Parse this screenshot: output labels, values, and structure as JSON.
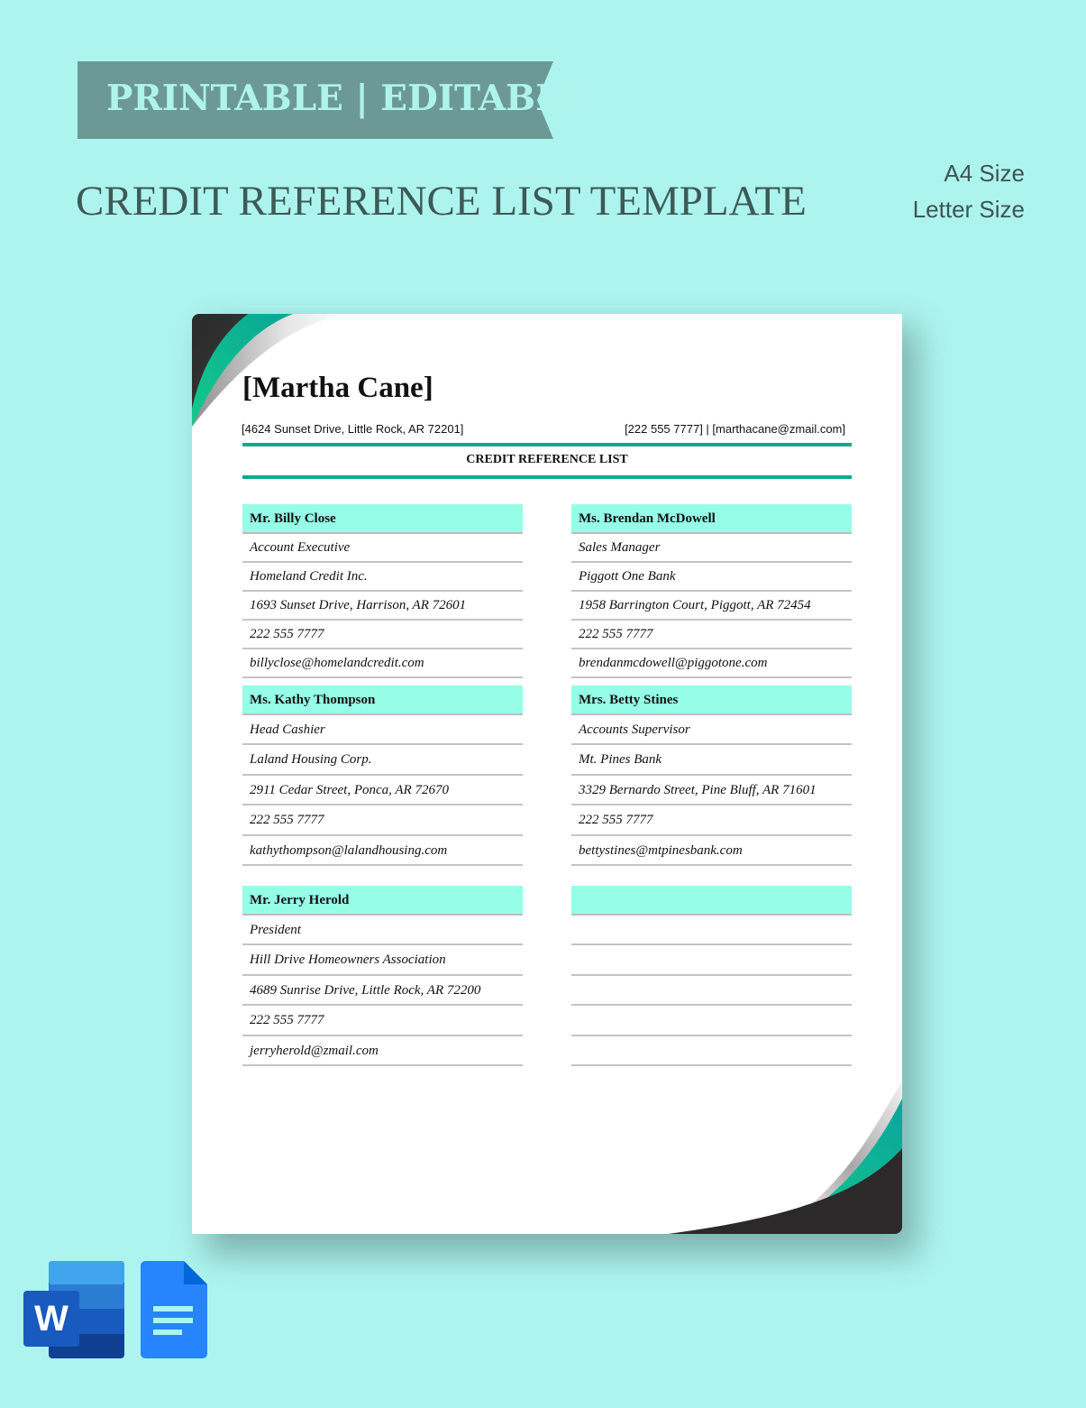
{
  "banner": {
    "label": "PRINTABLE | EDITABLE"
  },
  "title": "CREDIT REFERENCE LIST TEMPLATE",
  "sizes": [
    "A4 Size",
    "Letter Size"
  ],
  "colors": {
    "background": "#adf4ef",
    "banner": "#6c9995",
    "accent": "#0eaa8c",
    "header_fill": "#96fde7"
  },
  "document": {
    "name": "[Martha Cane]",
    "address": "[4624 Sunset Drive, Little Rock, AR 72201]",
    "contact": "[222 555 7777] | [marthacane@zmail.com]",
    "heading": "CREDIT REFERENCE LIST",
    "references": [
      {
        "name": "Mr. Billy Close",
        "lines": [
          "Account Executive",
          "Homeland Credit Inc.",
          "1693 Sunset Drive, Harrison, AR 72601",
          "222 555 7777",
          "billyclose@homelandcredit.com"
        ]
      },
      {
        "name": "Ms. Brendan McDowell",
        "lines": [
          "Sales Manager",
          "Piggott One Bank",
          "1958 Barrington Court, Piggott, AR 72454",
          "222 555 7777",
          "brendanmcdowell@piggotone.com"
        ]
      },
      {
        "name": "Ms. Kathy Thompson",
        "lines": [
          "Head Cashier",
          "Laland Housing Corp.",
          "2911 Cedar Street, Ponca, AR 72670",
          "222 555 7777",
          "kathythompson@lalandhousing.com"
        ]
      },
      {
        "name": "Mrs. Betty Stines",
        "lines": [
          "Accounts Supervisor",
          "Mt. Pines Bank",
          "3329 Bernardo Street, Pine Bluff, AR 71601",
          "222 555 7777",
          "bettystines@mtpinesbank.com"
        ]
      },
      {
        "name": "Mr. Jerry Herold",
        "lines": [
          "President",
          "Hill Drive Homeowners Association",
          "4689 Sunrise Drive, Little Rock, AR 72200",
          "222 555 7777",
          "jerryherold@zmail.com"
        ]
      },
      {
        "name": "",
        "lines": [
          "",
          "",
          "",
          "",
          ""
        ]
      }
    ]
  },
  "apps": [
    {
      "icon": "microsoft-word-icon",
      "letter": "W"
    },
    {
      "icon": "google-docs-icon"
    }
  ]
}
